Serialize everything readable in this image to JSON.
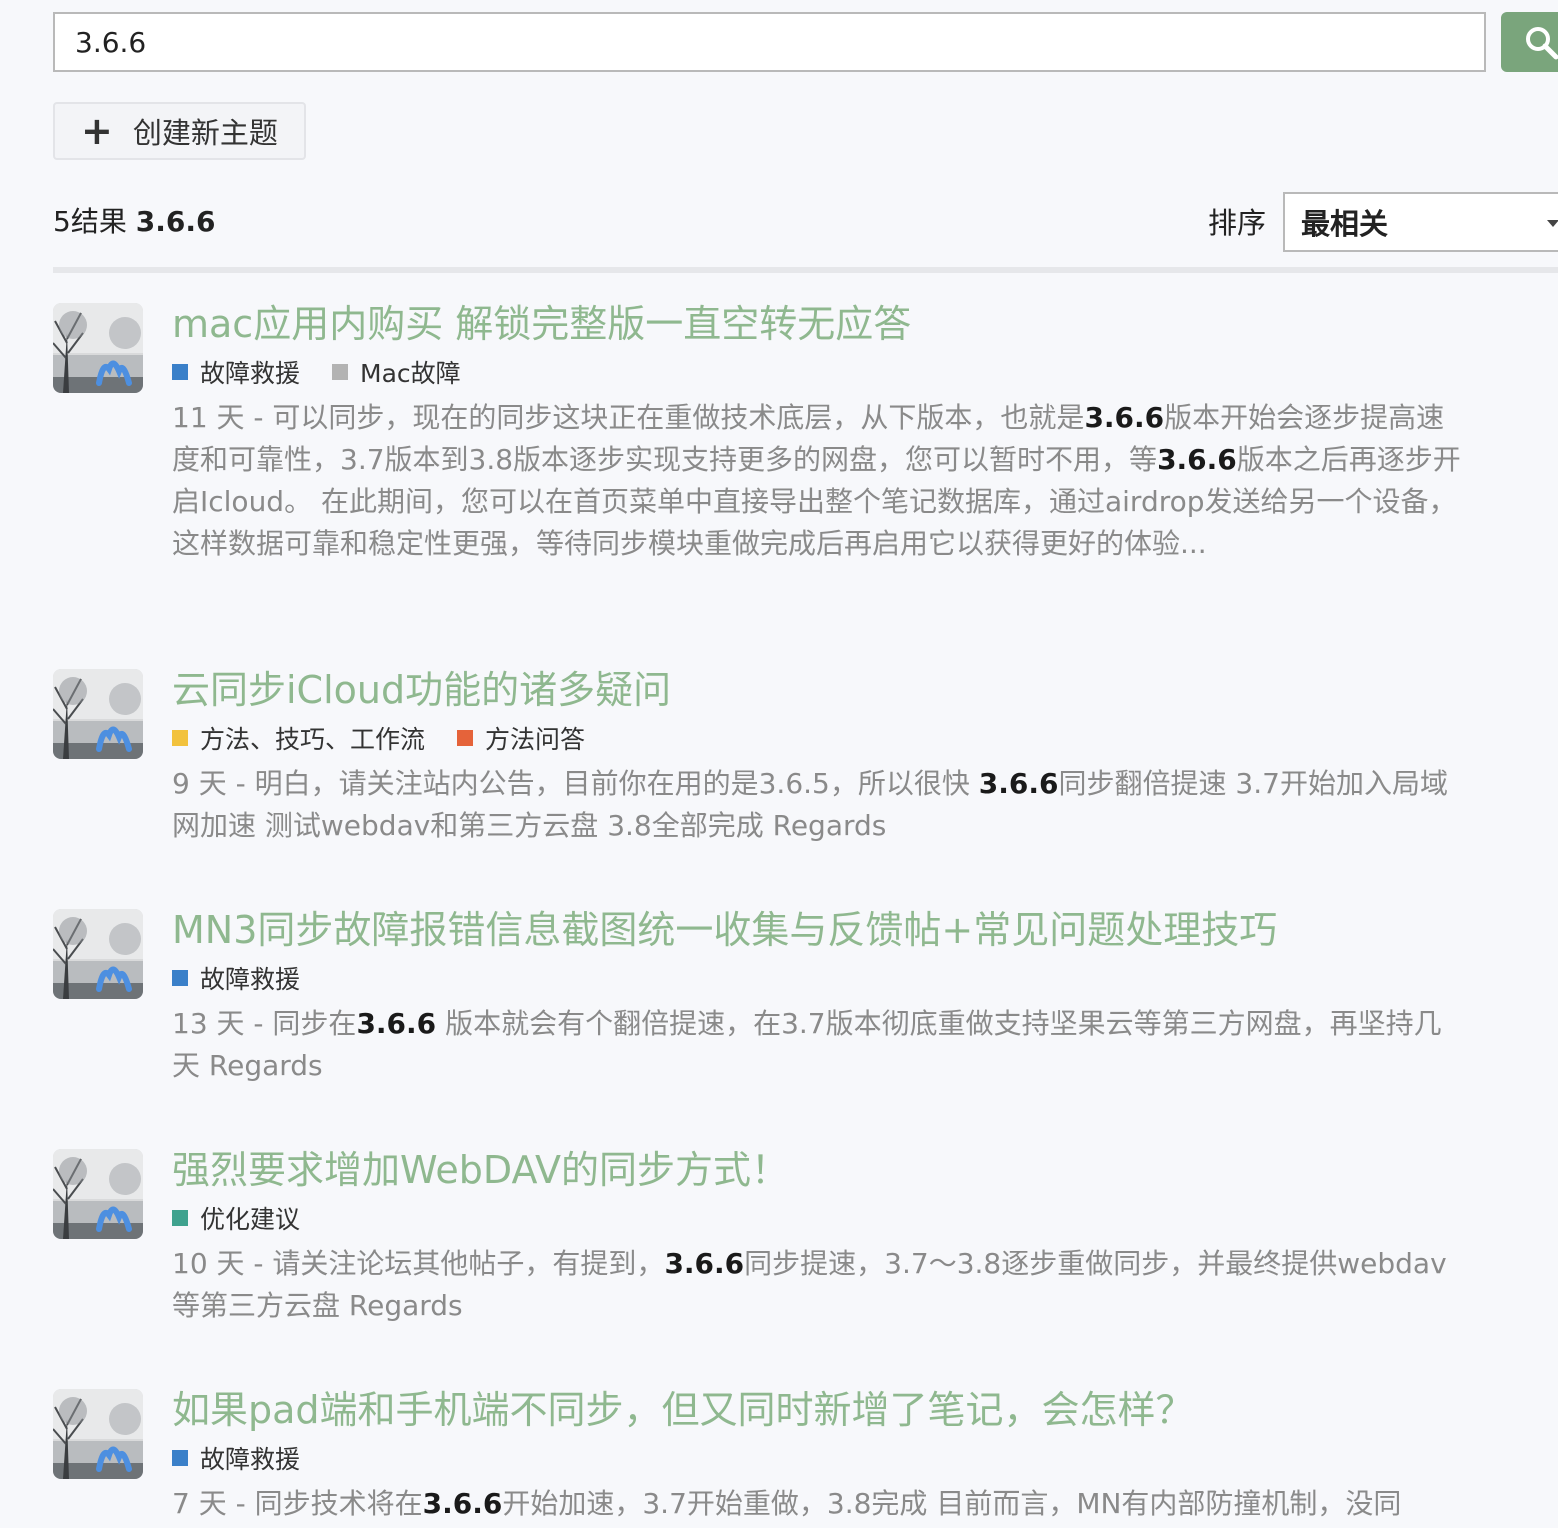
{
  "search": {
    "query": "3.6.6"
  },
  "new_topic": {
    "label": "创建新主题"
  },
  "results_header": {
    "count_text": "5结果",
    "query_bold": "3.6.6",
    "sort_label": "排序",
    "sort_value": "最相关"
  },
  "colors": {
    "accent": "#8fb88f",
    "search_button": "#7aa57c"
  },
  "results": [
    {
      "title": "mac应用内购买 解锁完整版一直空转无应答",
      "tags": [
        {
          "name": "故障救援",
          "color": "#3a80c9"
        },
        {
          "name": "Mac故障",
          "color": "#b3b3b3"
        }
      ],
      "excerpt": [
        {
          "t": "11 天 - 可以同步，现在的同步这块正在重做技术底层，从下版本，也就是"
        },
        {
          "t": "3.6.6",
          "b": true
        },
        {
          "t": "版本开始会逐步提高速度和可靠性，3.7版本到3.8版本逐步实现支持更多的网盘，您可以暂时不用，等"
        },
        {
          "t": "3.6.6",
          "b": true
        },
        {
          "t": "版本之后再逐步开启Icloud。 在此期间，您可以在首页菜单中直接导出整个笔记数据库，通过airdrop发送给另一个设备，这样数据可靠和稳定性更强，等待同步模块重做完成后再启用它以获得更好的体验..."
        }
      ]
    },
    {
      "title": "云同步iCloud功能的诸多疑问",
      "tags": [
        {
          "name": "方法、技巧、工作流",
          "color": "#f2c23d"
        },
        {
          "name": "方法问答",
          "color": "#e5633a"
        }
      ],
      "excerpt": [
        {
          "t": "9 天 - 明白，请关注站内公告，目前你在用的是3.6.5，所以很快 "
        },
        {
          "t": "3.6.6",
          "b": true
        },
        {
          "t": "同步翻倍提速 3.7开始加入局域网加速 测试webdav和第三方云盘 3.8全部完成 Regards"
        }
      ]
    },
    {
      "title": "MN3同步故障报错信息截图统一收集与反馈帖+常见问题处理技巧",
      "tags": [
        {
          "name": "故障救援",
          "color": "#3a80c9"
        }
      ],
      "excerpt": [
        {
          "t": "13 天 - 同步在"
        },
        {
          "t": "3.6.6",
          "b": true
        },
        {
          "t": " 版本就会有个翻倍提速，在3.7版本彻底重做支持坚果云等第三方网盘，再坚持几天 Regards"
        }
      ]
    },
    {
      "title": "强烈要求增加WebDAV的同步方式！",
      "tags": [
        {
          "name": "优化建议",
          "color": "#3fa28e"
        }
      ],
      "excerpt": [
        {
          "t": "10 天 - 请关注论坛其他帖子，有提到，"
        },
        {
          "t": "3.6.6",
          "b": true
        },
        {
          "t": "同步提速，3.7～3.8逐步重做同步，并最终提供webdav等第三方云盘 Regards"
        }
      ]
    },
    {
      "title": "如果pad端和手机端不同步，但又同时新增了笔记，会怎样？",
      "tags": [
        {
          "name": "故障救援",
          "color": "#3a80c9"
        }
      ],
      "excerpt": [
        {
          "t": "7 天 - 同步技术将在"
        },
        {
          "t": "3.6.6",
          "b": true
        },
        {
          "t": "开始加速，3.7开始重做，3.8完成 目前而言，MN有内部防撞机制，没同"
        }
      ]
    }
  ]
}
